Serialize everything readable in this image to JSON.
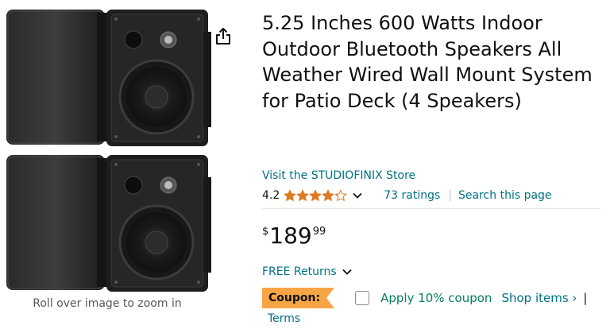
{
  "gallery": {
    "zoom_hint": "Roll over image to zoom in",
    "images": [
      {
        "name": "speaker-pair-image-top"
      },
      {
        "name": "speaker-pair-image-bottom"
      }
    ],
    "share_icon": "share-icon"
  },
  "product": {
    "title": "5.25 Inches 600 Watts Indoor Outdoor Bluetooth Speakers All Weather Wired Wall Mount System for Patio Deck (4 Speakers)",
    "store_link": "Visit the STUDIOFINIX Store",
    "rating": {
      "value": "4.2",
      "stars_filled": 4.2,
      "stars_total": 5,
      "ratings_count": "73 ratings",
      "separator": "|",
      "search_link": "Search this page"
    },
    "price": {
      "symbol": "$",
      "whole": "189",
      "fraction": "99"
    },
    "free_returns": "FREE Returns",
    "coupon": {
      "badge": "Coupon:",
      "apply_label": "Apply 10% coupon",
      "shop_items": "Shop items ›",
      "separator": "|",
      "terms": "Terms"
    }
  },
  "colors": {
    "link": "#007185",
    "star": "#de7921",
    "coupon_badge": "#f7a545",
    "coupon_text": "#067d62",
    "text": "#0f1111"
  }
}
